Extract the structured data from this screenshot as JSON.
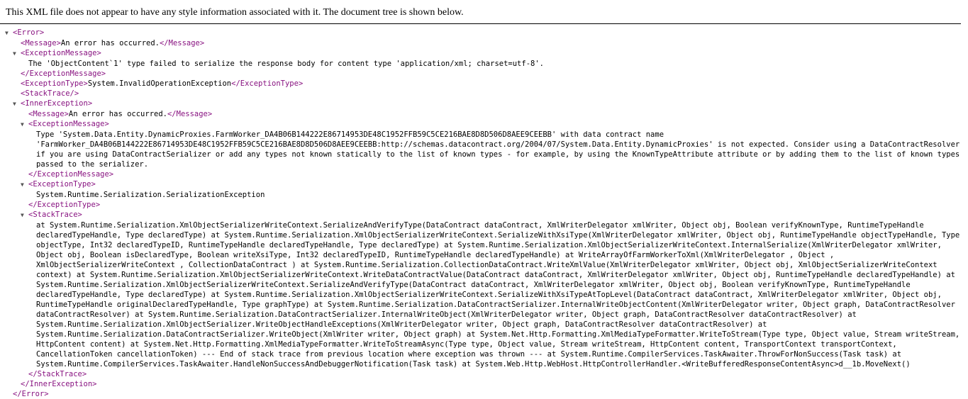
{
  "notice": "This XML file does not appear to have any style information associated with it. The document tree is shown below.",
  "arrow": "▼",
  "tags": {
    "error_open": "<Error>",
    "error_close": "</Error>",
    "message_open": "<Message>",
    "message_close": "</Message>",
    "exmsg_open": "<ExceptionMessage>",
    "exmsg_close": "</ExceptionMessage>",
    "extype_open": "<ExceptionType>",
    "extype_close": "</ExceptionType>",
    "stacktrace_empty": "<StackTrace/>",
    "stacktrace_open": "<StackTrace>",
    "stacktrace_close": "</StackTrace>",
    "inner_open": "<InnerException>",
    "inner_close": "</InnerException>"
  },
  "error": {
    "message": "An error has occurred.",
    "exception_message": "The 'ObjectContent`1' type failed to serialize the response body for content type 'application/xml; charset=utf-8'.",
    "exception_type": "System.InvalidOperationException"
  },
  "inner": {
    "message": "An error has occurred.",
    "exception_message": "Type 'System.Data.Entity.DynamicProxies.FarmWorker_DA4B06B144222E86714953DE48C1952FFB59C5CE216BAE8D8D506D8AEE9CEEBB' with data contract name 'FarmWorker_DA4B06B144222E86714953DE48C1952FFB59C5CE216BAE8D8D506D8AEE9CEEBB:http://schemas.datacontract.org/2004/07/System.Data.Entity.DynamicProxies' is not expected. Consider using a DataContractResolver if you are using DataContractSerializer or add any types not known statically to the list of known types - for example, by using the KnownTypeAttribute attribute or by adding them to the list of known types passed to the serializer.",
    "exception_type": "System.Runtime.Serialization.SerializationException",
    "stack_trace": "at System.Runtime.Serialization.XmlObjectSerializerWriteContext.SerializeAndVerifyType(DataContract dataContract, XmlWriterDelegator xmlWriter, Object obj, Boolean verifyKnownType, RuntimeTypeHandle declaredTypeHandle, Type declaredType) at System.Runtime.Serialization.XmlObjectSerializerWriteContext.SerializeWithXsiType(XmlWriterDelegator xmlWriter, Object obj, RuntimeTypeHandle objectTypeHandle, Type objectType, Int32 declaredTypeID, RuntimeTypeHandle declaredTypeHandle, Type declaredType) at System.Runtime.Serialization.XmlObjectSerializerWriteContext.InternalSerialize(XmlWriterDelegator xmlWriter, Object obj, Boolean isDeclaredType, Boolean writeXsiType, Int32 declaredTypeID, RuntimeTypeHandle declaredTypeHandle) at WriteArrayOfFarmWorkerToXml(XmlWriterDelegator , Object , XmlObjectSerializerWriteContext , CollectionDataContract ) at System.Runtime.Serialization.CollectionDataContract.WriteXmlValue(XmlWriterDelegator xmlWriter, Object obj, XmlObjectSerializerWriteContext context) at System.Runtime.Serialization.XmlObjectSerializerWriteContext.WriteDataContractValue(DataContract dataContract, XmlWriterDelegator xmlWriter, Object obj, RuntimeTypeHandle declaredTypeHandle) at System.Runtime.Serialization.XmlObjectSerializerWriteContext.SerializeAndVerifyType(DataContract dataContract, XmlWriterDelegator xmlWriter, Object obj, Boolean verifyKnownType, RuntimeTypeHandle declaredTypeHandle, Type declaredType) at System.Runtime.Serialization.XmlObjectSerializerWriteContext.SerializeWithXsiTypeAtTopLevel(DataContract dataContract, XmlWriterDelegator xmlWriter, Object obj, RuntimeTypeHandle originalDeclaredTypeHandle, Type graphType) at System.Runtime.Serialization.DataContractSerializer.InternalWriteObjectContent(XmlWriterDelegator writer, Object graph, DataContractResolver dataContractResolver) at System.Runtime.Serialization.DataContractSerializer.InternalWriteObject(XmlWriterDelegator writer, Object graph, DataContractResolver dataContractResolver) at System.Runtime.Serialization.XmlObjectSerializer.WriteObjectHandleExceptions(XmlWriterDelegator writer, Object graph, DataContractResolver dataContractResolver) at System.Runtime.Serialization.DataContractSerializer.WriteObject(XmlWriter writer, Object graph) at System.Net.Http.Formatting.XmlMediaTypeFormatter.WriteToStream(Type type, Object value, Stream writeStream, HttpContent content) at System.Net.Http.Formatting.XmlMediaTypeFormatter.WriteToStreamAsync(Type type, Object value, Stream writeStream, HttpContent content, TransportContext transportContext, CancellationToken cancellationToken) --- End of stack trace from previous location where exception was thrown --- at System.Runtime.CompilerServices.TaskAwaiter.ThrowForNonSuccess(Task task) at System.Runtime.CompilerServices.TaskAwaiter.HandleNonSuccessAndDebuggerNotification(Task task) at System.Web.Http.WebHost.HttpControllerHandler.<WriteBufferedResponseContentAsync>d__1b.MoveNext()"
  }
}
